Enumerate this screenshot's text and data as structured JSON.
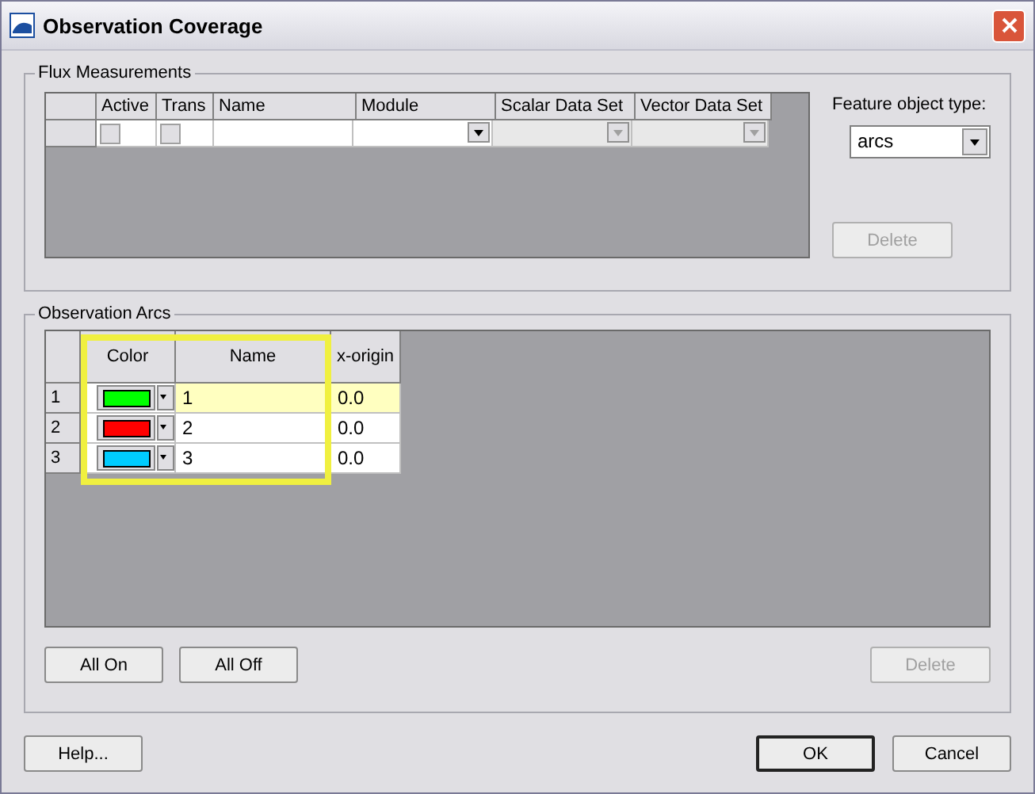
{
  "window": {
    "title": "Observation Coverage"
  },
  "flux": {
    "group_title": "Flux Measurements",
    "columns": [
      "Active",
      "Trans",
      "Name",
      "Module",
      "Scalar Data Set",
      "Vector Data Set"
    ],
    "rows": [
      {
        "active": false,
        "trans": false,
        "module_enabled": true,
        "scalar_enabled": false,
        "vector_enabled": false
      }
    ],
    "feature_label": "Feature object type:",
    "feature_value": "arcs",
    "delete_button": {
      "label": "Delete",
      "disabled": true
    }
  },
  "arcs": {
    "group_title": "Observation Arcs",
    "columns": [
      "Color",
      "Name",
      "x-origin"
    ],
    "highlight_box": true,
    "rows": [
      {
        "number": "1",
        "color": "#00ff00",
        "name": "1",
        "x_origin": "0.0",
        "selected": true
      },
      {
        "number": "2",
        "color": "#ff0000",
        "name": "2",
        "x_origin": "0.0",
        "selected": false
      },
      {
        "number": "3",
        "color": "#00ccff",
        "name": "3",
        "x_origin": "0.0",
        "selected": false
      }
    ],
    "buttons": [
      {
        "label": "All On",
        "disabled": false
      },
      {
        "label": "All Off",
        "disabled": false
      }
    ],
    "delete_button": {
      "label": "Delete",
      "disabled": true
    }
  },
  "footer": {
    "help": "Help...",
    "ok": "OK",
    "cancel": "Cancel"
  }
}
